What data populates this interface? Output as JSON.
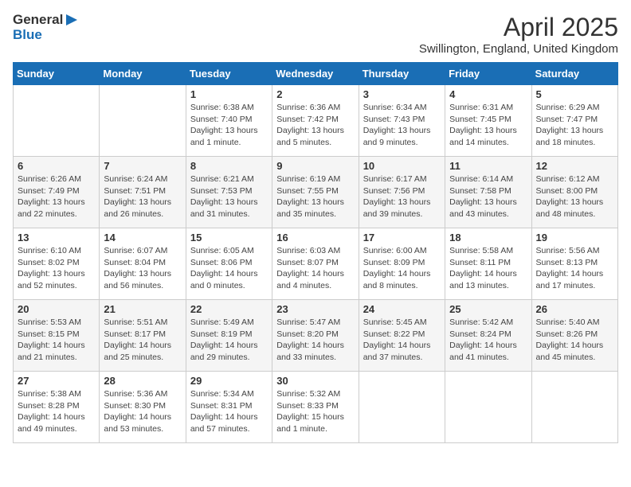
{
  "header": {
    "logo_general": "General",
    "logo_blue": "Blue",
    "month": "April 2025",
    "location": "Swillington, England, United Kingdom"
  },
  "days_of_week": [
    "Sunday",
    "Monday",
    "Tuesday",
    "Wednesday",
    "Thursday",
    "Friday",
    "Saturday"
  ],
  "weeks": [
    [
      {
        "day": "",
        "info": ""
      },
      {
        "day": "",
        "info": ""
      },
      {
        "day": "1",
        "info": "Sunrise: 6:38 AM\nSunset: 7:40 PM\nDaylight: 13 hours and 1 minute."
      },
      {
        "day": "2",
        "info": "Sunrise: 6:36 AM\nSunset: 7:42 PM\nDaylight: 13 hours and 5 minutes."
      },
      {
        "day": "3",
        "info": "Sunrise: 6:34 AM\nSunset: 7:43 PM\nDaylight: 13 hours and 9 minutes."
      },
      {
        "day": "4",
        "info": "Sunrise: 6:31 AM\nSunset: 7:45 PM\nDaylight: 13 hours and 14 minutes."
      },
      {
        "day": "5",
        "info": "Sunrise: 6:29 AM\nSunset: 7:47 PM\nDaylight: 13 hours and 18 minutes."
      }
    ],
    [
      {
        "day": "6",
        "info": "Sunrise: 6:26 AM\nSunset: 7:49 PM\nDaylight: 13 hours and 22 minutes."
      },
      {
        "day": "7",
        "info": "Sunrise: 6:24 AM\nSunset: 7:51 PM\nDaylight: 13 hours and 26 minutes."
      },
      {
        "day": "8",
        "info": "Sunrise: 6:21 AM\nSunset: 7:53 PM\nDaylight: 13 hours and 31 minutes."
      },
      {
        "day": "9",
        "info": "Sunrise: 6:19 AM\nSunset: 7:55 PM\nDaylight: 13 hours and 35 minutes."
      },
      {
        "day": "10",
        "info": "Sunrise: 6:17 AM\nSunset: 7:56 PM\nDaylight: 13 hours and 39 minutes."
      },
      {
        "day": "11",
        "info": "Sunrise: 6:14 AM\nSunset: 7:58 PM\nDaylight: 13 hours and 43 minutes."
      },
      {
        "day": "12",
        "info": "Sunrise: 6:12 AM\nSunset: 8:00 PM\nDaylight: 13 hours and 48 minutes."
      }
    ],
    [
      {
        "day": "13",
        "info": "Sunrise: 6:10 AM\nSunset: 8:02 PM\nDaylight: 13 hours and 52 minutes."
      },
      {
        "day": "14",
        "info": "Sunrise: 6:07 AM\nSunset: 8:04 PM\nDaylight: 13 hours and 56 minutes."
      },
      {
        "day": "15",
        "info": "Sunrise: 6:05 AM\nSunset: 8:06 PM\nDaylight: 14 hours and 0 minutes."
      },
      {
        "day": "16",
        "info": "Sunrise: 6:03 AM\nSunset: 8:07 PM\nDaylight: 14 hours and 4 minutes."
      },
      {
        "day": "17",
        "info": "Sunrise: 6:00 AM\nSunset: 8:09 PM\nDaylight: 14 hours and 8 minutes."
      },
      {
        "day": "18",
        "info": "Sunrise: 5:58 AM\nSunset: 8:11 PM\nDaylight: 14 hours and 13 minutes."
      },
      {
        "day": "19",
        "info": "Sunrise: 5:56 AM\nSunset: 8:13 PM\nDaylight: 14 hours and 17 minutes."
      }
    ],
    [
      {
        "day": "20",
        "info": "Sunrise: 5:53 AM\nSunset: 8:15 PM\nDaylight: 14 hours and 21 minutes."
      },
      {
        "day": "21",
        "info": "Sunrise: 5:51 AM\nSunset: 8:17 PM\nDaylight: 14 hours and 25 minutes."
      },
      {
        "day": "22",
        "info": "Sunrise: 5:49 AM\nSunset: 8:19 PM\nDaylight: 14 hours and 29 minutes."
      },
      {
        "day": "23",
        "info": "Sunrise: 5:47 AM\nSunset: 8:20 PM\nDaylight: 14 hours and 33 minutes."
      },
      {
        "day": "24",
        "info": "Sunrise: 5:45 AM\nSunset: 8:22 PM\nDaylight: 14 hours and 37 minutes."
      },
      {
        "day": "25",
        "info": "Sunrise: 5:42 AM\nSunset: 8:24 PM\nDaylight: 14 hours and 41 minutes."
      },
      {
        "day": "26",
        "info": "Sunrise: 5:40 AM\nSunset: 8:26 PM\nDaylight: 14 hours and 45 minutes."
      }
    ],
    [
      {
        "day": "27",
        "info": "Sunrise: 5:38 AM\nSunset: 8:28 PM\nDaylight: 14 hours and 49 minutes."
      },
      {
        "day": "28",
        "info": "Sunrise: 5:36 AM\nSunset: 8:30 PM\nDaylight: 14 hours and 53 minutes."
      },
      {
        "day": "29",
        "info": "Sunrise: 5:34 AM\nSunset: 8:31 PM\nDaylight: 14 hours and 57 minutes."
      },
      {
        "day": "30",
        "info": "Sunrise: 5:32 AM\nSunset: 8:33 PM\nDaylight: 15 hours and 1 minute."
      },
      {
        "day": "",
        "info": ""
      },
      {
        "day": "",
        "info": ""
      },
      {
        "day": "",
        "info": ""
      }
    ]
  ]
}
